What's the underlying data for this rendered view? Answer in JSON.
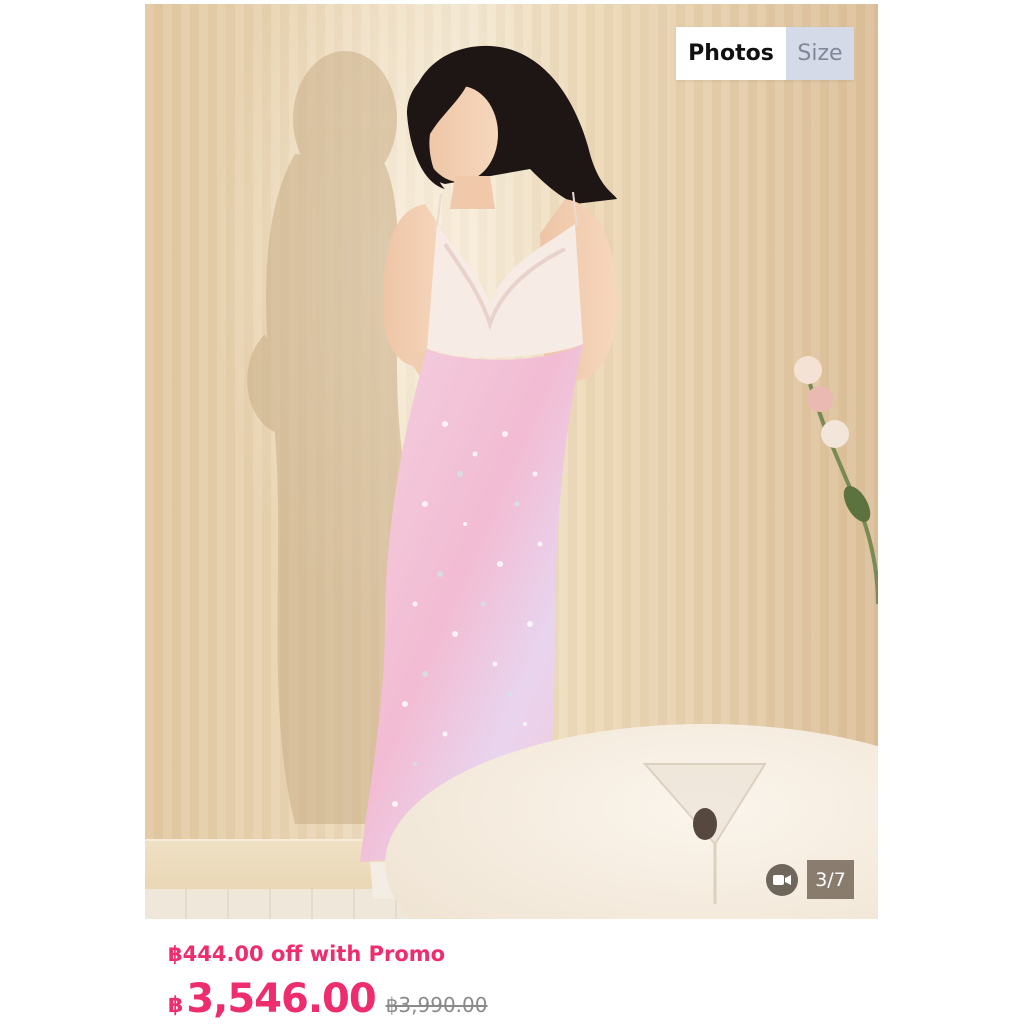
{
  "gallery": {
    "tabs": [
      {
        "label": "Photos",
        "active": true
      },
      {
        "label": "Size",
        "active": false
      }
    ],
    "counter": "3/7",
    "video_icon": "video-camera-icon",
    "photo_subject": "product-photo"
  },
  "pricing": {
    "promo_text": "฿444.00 off with Promo",
    "currency_symbol": "฿",
    "current_price": "3,546.00",
    "original_price": "฿3,990.00"
  },
  "colors": {
    "accent": "#ee2d6f",
    "tab_inactive_bg": "#d5dae8",
    "strikethrough": "#8a8a8a"
  }
}
